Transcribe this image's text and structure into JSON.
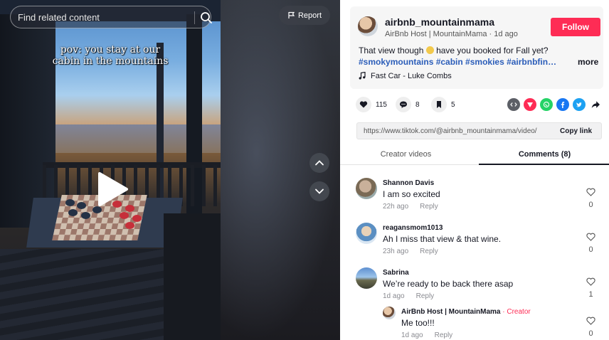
{
  "search": {
    "placeholder": "Find related content"
  },
  "report": {
    "label": "Report"
  },
  "video": {
    "caption_line1": "pov: you stay at our",
    "caption_line2": "cabin in the mountains"
  },
  "post": {
    "author_name": "airbnb_mountainmama",
    "author_sub": "AirBnb Host | MountainMama · 1d ago",
    "follow_label": "Follow",
    "text_before_emoji": "That view though ",
    "text_after_emoji": " have you booked for Fall yet?",
    "hashtags": "#smokymountains #cabin #smokies #airbnbfinds #travel",
    "more_label": "more",
    "music": "Fast Car - Luke Combs"
  },
  "actions": {
    "likes": "115",
    "comments": "8",
    "saves": "5"
  },
  "share_icons": [
    {
      "name": "embed-icon",
      "color": "#5c5f66"
    },
    {
      "name": "send-to-friends-icon",
      "color": "#fe2c55"
    },
    {
      "name": "whatsapp-icon",
      "color": "#25d366"
    },
    {
      "name": "facebook-icon",
      "color": "#1877f2"
    },
    {
      "name": "twitter-icon",
      "color": "#1da1f2"
    },
    {
      "name": "share-arrow-icon",
      "color": "#161823"
    }
  ],
  "link": {
    "url": "https://www.tiktok.com/@airbnb_mountainmama/video/",
    "copy_label": "Copy link"
  },
  "tabs": {
    "creator_videos": "Creator videos",
    "comments": "Comments (8)"
  },
  "comments": [
    {
      "user": "Shannon Davis",
      "text": "I am so excited",
      "time": "22h ago",
      "reply": "Reply",
      "likes": "0"
    },
    {
      "user": "reagansmom1013",
      "text": "Ah I miss that view & that wine.",
      "time": "23h ago",
      "reply": "Reply",
      "likes": "0"
    },
    {
      "user": "Sabrina",
      "text": "We’re ready to be back there asap",
      "time": "1d ago",
      "reply": "Reply",
      "likes": "1"
    }
  ],
  "reply": {
    "user": "AirBnb Host | MountainMama",
    "separator": " · ",
    "creator_tag": "Creator",
    "text": "Me too!!!",
    "time": "1d ago",
    "reply": "Reply",
    "likes": "0"
  },
  "colors": {
    "accent": "#fe2c55",
    "hashtag": "#2b5db9"
  }
}
